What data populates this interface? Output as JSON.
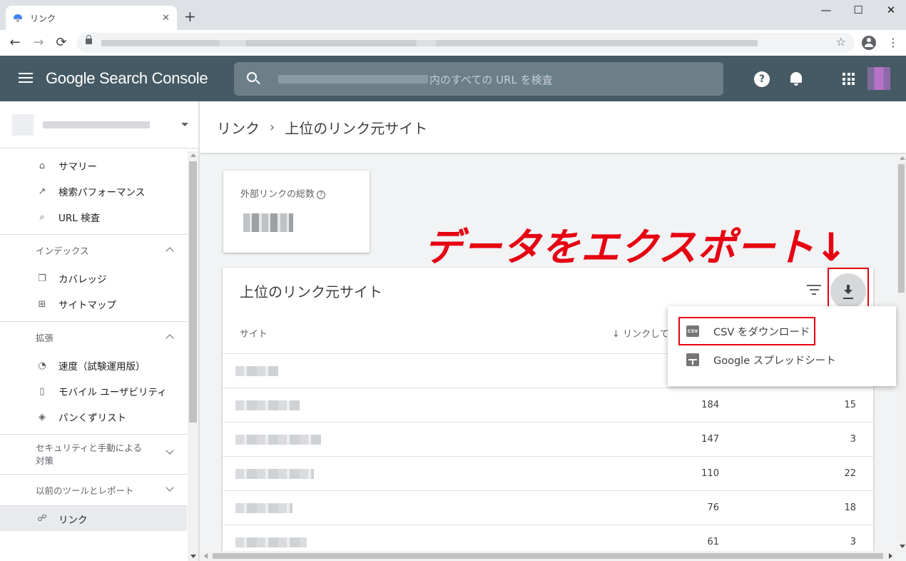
{
  "browser": {
    "tab_title": "リンク",
    "tab_close": "✕",
    "new_tab": "+",
    "window_controls": {
      "minimize": "—",
      "maximize": "☐",
      "close": "✕"
    },
    "nav": {
      "back": "←",
      "forward": "→",
      "reload": "⟳",
      "star": "☆",
      "menu": "⋮"
    }
  },
  "header": {
    "menu_icon": "hamburger-icon",
    "brand": "Google Search Console",
    "search_placeholder": "内のすべての URL を検査",
    "help": "?"
  },
  "sidebar": {
    "top_items": [
      {
        "icon": "⌂",
        "label": "サマリー"
      },
      {
        "icon": "↗",
        "label": "検索パフォーマンス"
      },
      {
        "icon": "⌕",
        "label": "URL 検査"
      }
    ],
    "index_section": "インデックス",
    "index_items": [
      {
        "icon": "❐",
        "label": "カバレッジ"
      },
      {
        "icon": "⊞",
        "label": "サイトマップ"
      }
    ],
    "enhance_section": "拡張",
    "enhance_items": [
      {
        "icon": "◔",
        "label": "速度（試験運用版）"
      },
      {
        "icon": "▯",
        "label": "モバイル ユーザビリティ"
      },
      {
        "icon": "◈",
        "label": "パンくずリスト"
      }
    ],
    "security_section_line1": "セキュリティと手動による",
    "security_section_line2": "対策",
    "legacy_section": "以前のツールとレポート",
    "active_item": {
      "icon": "☍",
      "label": "リンク"
    }
  },
  "main": {
    "breadcrumb": {
      "parent": "リンク",
      "sep": "›",
      "current": "上位のリンク元サイト"
    },
    "total_card": {
      "label": "外部リンクの総数",
      "help": "?"
    },
    "annotation": "データをエクスポート↓",
    "table": {
      "title": "上位のリンク元サイト",
      "col_site": "サイト",
      "col_links": "↓ リンクして",
      "rows": [
        {
          "v1": "",
          "v2": ""
        },
        {
          "v1": "184",
          "v2": "15"
        },
        {
          "v1": "147",
          "v2": "3"
        },
        {
          "v1": "110",
          "v2": "22"
        },
        {
          "v1": "76",
          "v2": "18"
        },
        {
          "v1": "61",
          "v2": "3"
        }
      ]
    },
    "export_menu": {
      "csv_icon_text": "CSV",
      "csv": "CSV をダウンロード",
      "sheets": "Google スプレッドシート"
    }
  },
  "colors": {
    "header_bg": "#455a64",
    "annotation_red": "#e60012",
    "sidebar_active": "#e8eaed"
  }
}
